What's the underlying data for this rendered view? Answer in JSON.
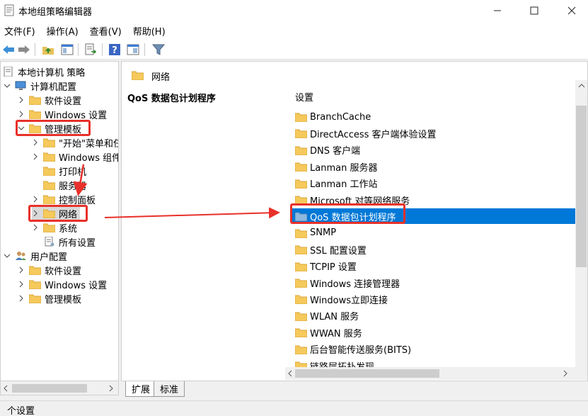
{
  "window": {
    "title": "本地组策略编辑器"
  },
  "menu": {
    "items": [
      "文件(F)",
      "操作(A)",
      "查看(V)",
      "帮助(H)"
    ]
  },
  "tree": {
    "root": "本地计算机 策略",
    "computer_config": "计算机配置",
    "cc_software": "软件设置",
    "cc_windows": "Windows 设置",
    "cc_admin": "管理模板",
    "at_start": "\"开始\"菜单和任",
    "at_windows": "Windows 组件",
    "at_printer": "打印机",
    "at_server": "服务器",
    "at_control": "控制面板",
    "at_network": "网络",
    "at_system": "系统",
    "at_all": "所有设置",
    "user_config": "用户配置",
    "uc_software": "软件设置",
    "uc_windows": "Windows 设置",
    "uc_admin": "管理模板"
  },
  "header": {
    "title": "网络"
  },
  "description": {
    "title": "QoS 数据包计划程序"
  },
  "list": {
    "column": "设置",
    "items": [
      "BranchCache",
      "DirectAccess 客户端体验设置",
      "DNS 客户端",
      "Lanman 服务器",
      "Lanman 工作站",
      "Microsoft 对等网络服务",
      "QoS 数据包计划程序",
      "SNMP",
      "SSL 配置设置",
      "TCPIP 设置",
      "Windows 连接管理器",
      "Windows立即连接",
      "WLAN 服务",
      "WWAN 服务",
      "后台智能传送服务(BITS)",
      "链路层拓扑发现"
    ],
    "selected": "QoS 数据包计划程序"
  },
  "tabs": {
    "expand": "扩展",
    "standard": "标准"
  },
  "status": {
    "text": "个设置"
  },
  "colors": {
    "selection": "#0078d7",
    "annotation": "#e8312a",
    "folder": "#f5c95b"
  }
}
